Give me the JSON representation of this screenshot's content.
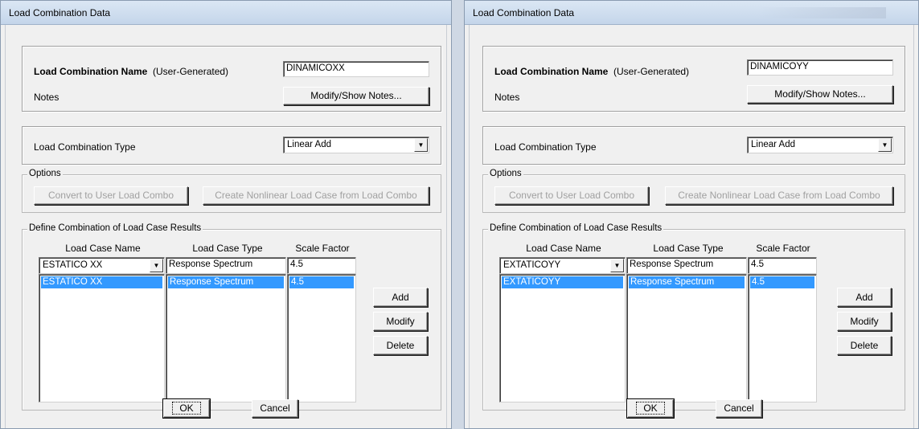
{
  "dialogs": [
    {
      "title": "Load Combination Data",
      "combo_name_label": "Load Combination Name",
      "combo_name_suffix": "(User-Generated)",
      "combo_name_value": "DINAMICOXX",
      "notes_label": "Notes",
      "notes_button": "Modify/Show Notes...",
      "type_label": "Load Combination Type",
      "type_value": "Linear Add",
      "options_title": "Options",
      "convert_button": "Convert to User Load Combo",
      "create_button": "Create Nonlinear Load Case from Load Combo",
      "define_title": "Define Combination of Load Case Results",
      "col_case_name": "Load Case Name",
      "col_case_type": "Load Case Type",
      "col_scale": "Scale Factor",
      "edit_case_name": "ESTATICO XX",
      "edit_case_type": "Response Spectrum",
      "edit_scale": "4.5",
      "rows": [
        {
          "case_name": "ESTATICO XX",
          "case_type": "Response Spectrum",
          "scale": "4.5"
        }
      ],
      "add_button": "Add",
      "modify_button": "Modify",
      "delete_button": "Delete",
      "ok_button": "OK",
      "cancel_button": "Cancel"
    },
    {
      "title": "Load Combination Data",
      "combo_name_label": "Load Combination Name",
      "combo_name_suffix": "(User-Generated)",
      "combo_name_value": "DINAMICOYY",
      "notes_label": "Notes",
      "notes_button": "Modify/Show Notes...",
      "type_label": "Load Combination Type",
      "type_value": "Linear Add",
      "options_title": "Options",
      "convert_button": "Convert to User Load Combo",
      "create_button": "Create Nonlinear Load Case from Load Combo",
      "define_title": "Define Combination of Load Case Results",
      "col_case_name": "Load Case Name",
      "col_case_type": "Load Case Type",
      "col_scale": "Scale Factor",
      "edit_case_name": "EXTATICOYY",
      "edit_case_type": "Response Spectrum",
      "edit_scale": "4.5",
      "rows": [
        {
          "case_name": "EXTATICOYY",
          "case_type": "Response Spectrum",
          "scale": "4.5"
        }
      ],
      "add_button": "Add",
      "modify_button": "Modify",
      "delete_button": "Delete",
      "ok_button": "OK",
      "cancel_button": "Cancel"
    }
  ],
  "colors": {
    "selection": "#3399ff",
    "dialog_bg": "#f0f0f0",
    "titlebar": "#c4d5ea"
  },
  "icons": {
    "dropdown": "chevron-down-icon"
  }
}
